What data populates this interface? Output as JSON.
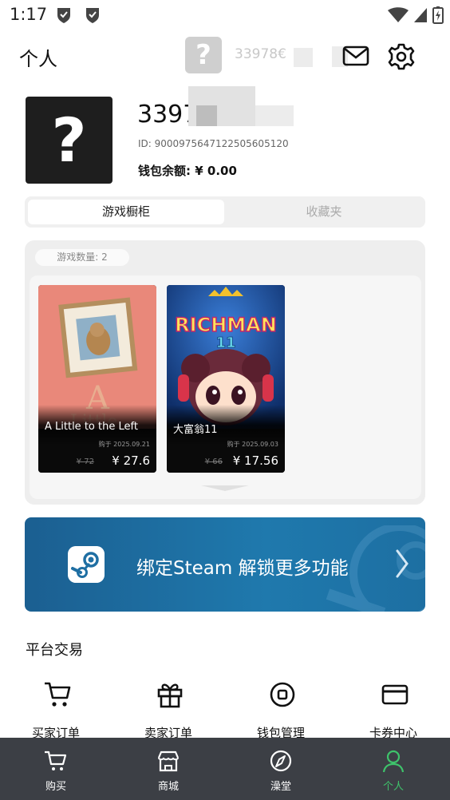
{
  "status_bar": {
    "time": "1:17"
  },
  "header": {
    "title": "个人",
    "username_short": "33978€"
  },
  "profile": {
    "avatar_glyph": "?",
    "name": "3397",
    "id": "ID: 9000975647122505605120",
    "wallet": "钱包余额: ¥ 0.00"
  },
  "tabs": [
    {
      "label": "游戏橱柜",
      "active": true
    },
    {
      "label": "收藏夹",
      "active": false
    }
  ],
  "shelf": {
    "count_label": "游戏数量: 2",
    "games": [
      {
        "title": "A Little to the Left",
        "date": "购于 2025.09.21",
        "old_price": "¥ 72",
        "price": "¥ 27.6"
      },
      {
        "title": "大富翁11",
        "date": "购于 2025.09.03",
        "old_price": "¥ 66",
        "price": "¥ 17.56"
      }
    ]
  },
  "steam_banner": {
    "text": "绑定Steam 解锁更多功能"
  },
  "trade_section": {
    "title": "平台交易",
    "items": [
      {
        "label": "买家订单",
        "icon": "cart-icon"
      },
      {
        "label": "卖家订单",
        "icon": "gift-icon"
      },
      {
        "label": "钱包管理",
        "icon": "wallet-icon"
      },
      {
        "label": "卡券中心",
        "icon": "card-icon"
      }
    ]
  },
  "bottom_nav": {
    "items": [
      {
        "label": "购买",
        "icon": "cart-icon",
        "active": false
      },
      {
        "label": "商城",
        "icon": "store-icon",
        "active": false
      },
      {
        "label": "澡堂",
        "icon": "compass-icon",
        "active": false
      },
      {
        "label": "个人",
        "icon": "person-icon",
        "active": true
      }
    ]
  },
  "colors": {
    "accent": "#3ec36b",
    "nav_bg": "#3c3f45",
    "steam_blue": "#1f79ad"
  }
}
